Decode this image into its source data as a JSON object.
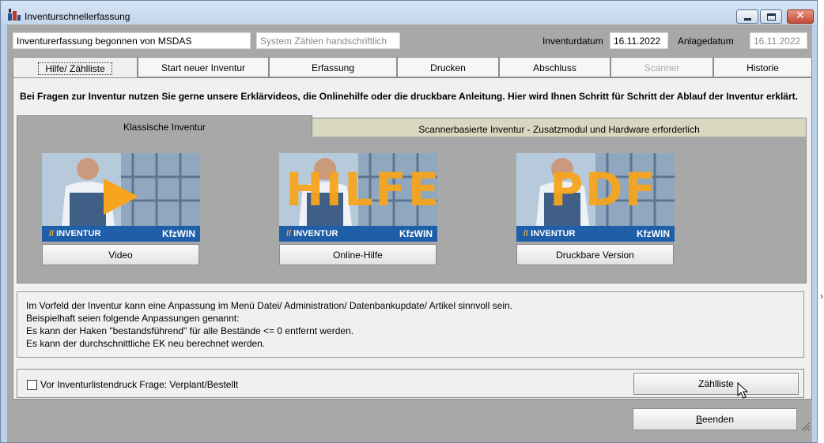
{
  "window": {
    "title": "Inventurschnellerfassung"
  },
  "header": {
    "started_by": "Inventurerfassung begonnen von MSDAS",
    "system_mode": "System Zählen handschriftlich",
    "inventory_date_label": "Inventurdatum",
    "inventory_date": "16.11.2022",
    "created_date_label": "Anlagedatum",
    "created_date": "16.11.2022"
  },
  "tabs": [
    {
      "label": "Hilfe/ Zählliste",
      "active": true,
      "disabled": false
    },
    {
      "label": "Start neuer Inventur",
      "active": false,
      "disabled": false
    },
    {
      "label": "Erfassung",
      "active": false,
      "disabled": false
    },
    {
      "label": "Drucken",
      "active": false,
      "disabled": false
    },
    {
      "label": "Abschluss",
      "active": false,
      "disabled": false
    },
    {
      "label": "Scanner",
      "active": false,
      "disabled": true
    },
    {
      "label": "Historie",
      "active": false,
      "disabled": false
    }
  ],
  "intro_text": "Bei Fragen zur Inventur nutzen Sie gerne unsere Erklärvideos, die Onlinehilfe oder die druckbare Anleitung. Hier wird Ihnen Schritt für Schritt der Ablauf der Inventur erklärt.",
  "subtabs": {
    "classic": "Klassische Inventur",
    "scanner": "Scannerbasierte Inventur - Zusatzmodul und Hardware erforderlich"
  },
  "cards": [
    {
      "overlay": "",
      "brand_left": "INVENTUR",
      "brand_right": "KfzWIN",
      "button": "Video",
      "icon": "play-icon"
    },
    {
      "overlay": "HILFE",
      "brand_left": "INVENTUR",
      "brand_right": "KfzWIN",
      "button": "Online-Hilfe",
      "icon": "help-overlay"
    },
    {
      "overlay": "PDF",
      "brand_left": "INVENTUR",
      "brand_right": "KfzWIN",
      "button": "Druckbare Version",
      "icon": "pdf-overlay"
    }
  ],
  "info_lines": [
    "Im Vorfeld der Inventur kann eine Anpassung im Menü Datei/ Administration/ Datenbankupdate/ Artikel sinnvoll sein.",
    "Beispielhaft seien folgende Anpassungen genannt:",
    "Es kann der Haken \"bestandsführend\" für alle Bestände <= 0 entfernt werden.",
    "Es kann der durchschnittliche EK neu berechnet werden."
  ],
  "options": {
    "checkbox_label": "Vor Inventurlistendruck Frage: Verplant/Bestellt",
    "checked": false,
    "count_list_button": "Zählliste"
  },
  "footer": {
    "exit_button": "Beenden"
  },
  "colors": {
    "brand_blue": "#1f5ea8",
    "accent_orange": "#f7a51e",
    "panel_gray": "#a8a8a8"
  }
}
